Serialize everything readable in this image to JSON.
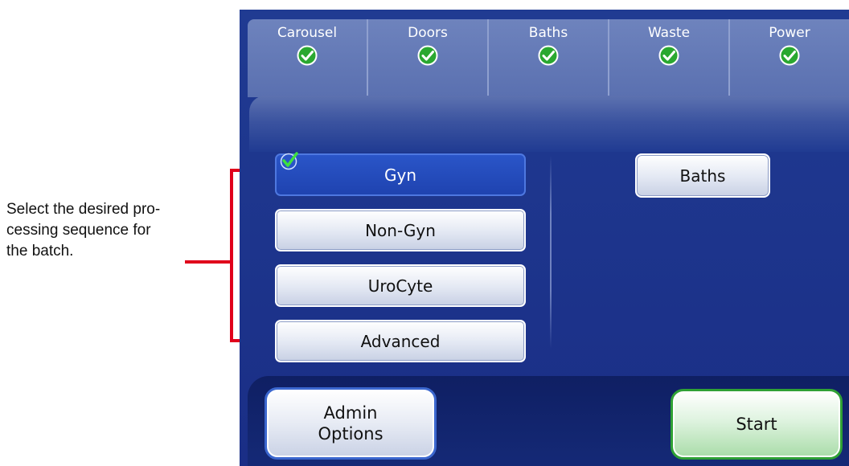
{
  "annotation": {
    "text": "Select the desired pro-\ncessing sequence for\nthe batch.",
    "line_color": "#e0001b"
  },
  "status": [
    {
      "label": "Carousel",
      "state": "ok",
      "icon": "check-circle-icon"
    },
    {
      "label": "Doors",
      "state": "ok",
      "icon": "check-circle-icon"
    },
    {
      "label": "Baths",
      "state": "ok",
      "icon": "check-circle-icon"
    },
    {
      "label": "Waste",
      "state": "ok",
      "icon": "check-circle-icon"
    },
    {
      "label": "Power",
      "state": "ok",
      "icon": "check-circle-icon"
    }
  ],
  "sequences": [
    {
      "label": "Gyn",
      "selected": true
    },
    {
      "label": "Non-Gyn",
      "selected": false
    },
    {
      "label": "UroCyte",
      "selected": false
    },
    {
      "label": "Advanced",
      "selected": false
    }
  ],
  "baths_button": "Baths",
  "admin_button": "Admin\nOptions",
  "start_button": "Start",
  "colors": {
    "screen_bg": "#1f3a90",
    "selected_button": "#1f43b0",
    "status_ok": "#2aa830",
    "start_accent": "#2fa135",
    "admin_accent": "#3b67cf"
  }
}
